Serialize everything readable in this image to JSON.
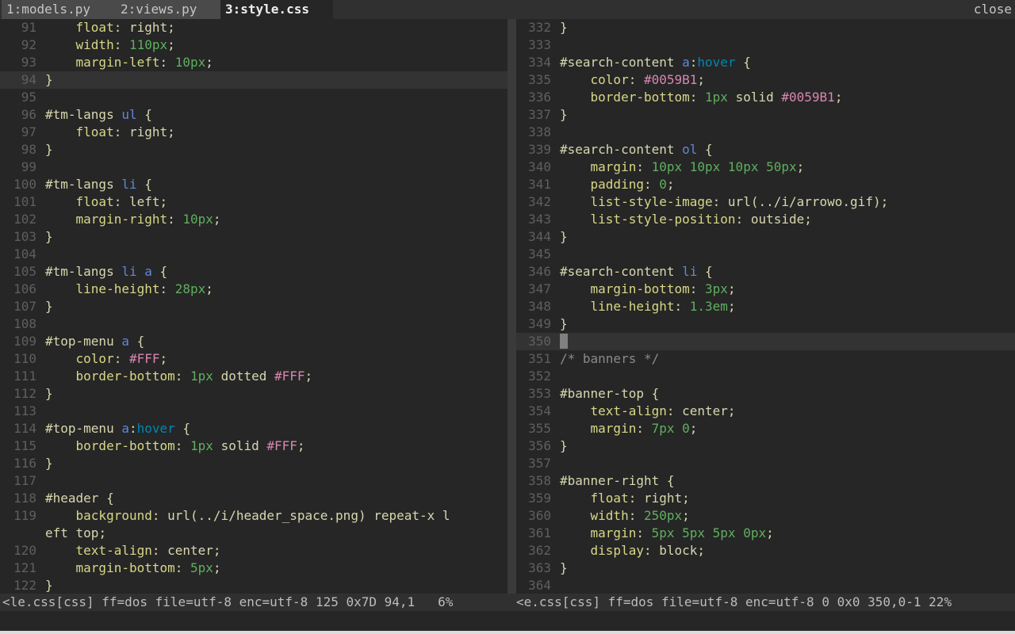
{
  "tabline": {
    "tabs": [
      {
        "label": "1:models.py"
      },
      {
        "label": "2:views.py"
      },
      {
        "label": "3:style.css"
      }
    ],
    "close_label": "close"
  },
  "left_pane": {
    "status": "<le.css[css] ff=dos file=utf-8 enc=utf-8 125 0x7D 94,1   6%",
    "lines": [
      {
        "num": "91",
        "tokens": [
          [
            "plain",
            "    "
          ],
          [
            "prop",
            "float"
          ],
          [
            "punct",
            ": "
          ],
          [
            "val",
            "right"
          ],
          [
            "punct",
            ";"
          ]
        ]
      },
      {
        "num": "92",
        "tokens": [
          [
            "plain",
            "    "
          ],
          [
            "prop",
            "width"
          ],
          [
            "punct",
            ": "
          ],
          [
            "num",
            "110px"
          ],
          [
            "punct",
            ";"
          ]
        ]
      },
      {
        "num": "93",
        "tokens": [
          [
            "plain",
            "    "
          ],
          [
            "prop",
            "margin-left"
          ],
          [
            "punct",
            ": "
          ],
          [
            "num",
            "10px"
          ],
          [
            "punct",
            ";"
          ]
        ]
      },
      {
        "num": "94",
        "cursorline": true,
        "tokens": [
          [
            "brace",
            "}"
          ]
        ]
      },
      {
        "num": "95",
        "tokens": []
      },
      {
        "num": "96",
        "tokens": [
          [
            "sel",
            "#tm-langs "
          ],
          [
            "tag",
            "ul"
          ],
          [
            "brace",
            " {"
          ]
        ]
      },
      {
        "num": "97",
        "tokens": [
          [
            "plain",
            "    "
          ],
          [
            "prop",
            "float"
          ],
          [
            "punct",
            ": "
          ],
          [
            "val",
            "right"
          ],
          [
            "punct",
            ";"
          ]
        ]
      },
      {
        "num": "98",
        "tokens": [
          [
            "brace",
            "}"
          ]
        ]
      },
      {
        "num": "99",
        "tokens": []
      },
      {
        "num": "100",
        "tokens": [
          [
            "sel",
            "#tm-langs "
          ],
          [
            "tag",
            "li"
          ],
          [
            "brace",
            " {"
          ]
        ]
      },
      {
        "num": "101",
        "tokens": [
          [
            "plain",
            "    "
          ],
          [
            "prop",
            "float"
          ],
          [
            "punct",
            ": "
          ],
          [
            "val",
            "left"
          ],
          [
            "punct",
            ";"
          ]
        ]
      },
      {
        "num": "102",
        "tokens": [
          [
            "plain",
            "    "
          ],
          [
            "prop",
            "margin-right"
          ],
          [
            "punct",
            ": "
          ],
          [
            "num",
            "10px"
          ],
          [
            "punct",
            ";"
          ]
        ]
      },
      {
        "num": "103",
        "tokens": [
          [
            "brace",
            "}"
          ]
        ]
      },
      {
        "num": "104",
        "tokens": []
      },
      {
        "num": "105",
        "tokens": [
          [
            "sel",
            "#tm-langs "
          ],
          [
            "tag",
            "li a"
          ],
          [
            "brace",
            " {"
          ]
        ]
      },
      {
        "num": "106",
        "tokens": [
          [
            "plain",
            "    "
          ],
          [
            "prop",
            "line-height"
          ],
          [
            "punct",
            ": "
          ],
          [
            "num",
            "28px"
          ],
          [
            "punct",
            ";"
          ]
        ]
      },
      {
        "num": "107",
        "tokens": [
          [
            "brace",
            "}"
          ]
        ]
      },
      {
        "num": "108",
        "tokens": []
      },
      {
        "num": "109",
        "tokens": [
          [
            "sel",
            "#top-menu "
          ],
          [
            "tag",
            "a"
          ],
          [
            "brace",
            " {"
          ]
        ]
      },
      {
        "num": "110",
        "tokens": [
          [
            "plain",
            "    "
          ],
          [
            "prop",
            "color"
          ],
          [
            "punct",
            ": "
          ],
          [
            "color",
            "#FFF"
          ],
          [
            "punct",
            ";"
          ]
        ]
      },
      {
        "num": "111",
        "tokens": [
          [
            "plain",
            "    "
          ],
          [
            "prop",
            "border-bottom"
          ],
          [
            "punct",
            ": "
          ],
          [
            "num",
            "1px"
          ],
          [
            "val",
            " dotted "
          ],
          [
            "color",
            "#FFF"
          ],
          [
            "punct",
            ";"
          ]
        ]
      },
      {
        "num": "112",
        "tokens": [
          [
            "brace",
            "}"
          ]
        ]
      },
      {
        "num": "113",
        "tokens": []
      },
      {
        "num": "114",
        "tokens": [
          [
            "sel",
            "#top-menu "
          ],
          [
            "tag",
            "a"
          ],
          [
            "punct",
            ":"
          ],
          [
            "pseudo",
            "hover"
          ],
          [
            "brace",
            " {"
          ]
        ]
      },
      {
        "num": "115",
        "tokens": [
          [
            "plain",
            "    "
          ],
          [
            "prop",
            "border-bottom"
          ],
          [
            "punct",
            ": "
          ],
          [
            "num",
            "1px"
          ],
          [
            "val",
            " solid "
          ],
          [
            "color",
            "#FFF"
          ],
          [
            "punct",
            ";"
          ]
        ]
      },
      {
        "num": "116",
        "tokens": [
          [
            "brace",
            "}"
          ]
        ]
      },
      {
        "num": "117",
        "tokens": []
      },
      {
        "num": "118",
        "tokens": [
          [
            "sel",
            "#header"
          ],
          [
            "brace",
            " {"
          ]
        ]
      },
      {
        "num": "119",
        "tokens": [
          [
            "plain",
            "    "
          ],
          [
            "prop",
            "background"
          ],
          [
            "punct",
            ": "
          ],
          [
            "val",
            "url(../i/header_space.png) repeat-x l"
          ]
        ]
      },
      {
        "num": "",
        "tokens": [
          [
            "val",
            "eft top"
          ],
          [
            "punct",
            ";"
          ]
        ]
      },
      {
        "num": "120",
        "tokens": [
          [
            "plain",
            "    "
          ],
          [
            "prop",
            "text-align"
          ],
          [
            "punct",
            ": "
          ],
          [
            "val",
            "center"
          ],
          [
            "punct",
            ";"
          ]
        ]
      },
      {
        "num": "121",
        "tokens": [
          [
            "plain",
            "    "
          ],
          [
            "prop",
            "margin-bottom"
          ],
          [
            "punct",
            ": "
          ],
          [
            "num",
            "5px"
          ],
          [
            "punct",
            ";"
          ]
        ]
      },
      {
        "num": "122",
        "tokens": [
          [
            "brace",
            "}"
          ]
        ]
      }
    ]
  },
  "right_pane": {
    "status": "<e.css[css] ff=dos file=utf-8 enc=utf-8 0 0x0 350,0-1 22%",
    "lines": [
      {
        "num": "332",
        "tokens": [
          [
            "brace",
            "}"
          ]
        ]
      },
      {
        "num": "333",
        "tokens": []
      },
      {
        "num": "334",
        "tokens": [
          [
            "sel",
            "#search-content "
          ],
          [
            "tag",
            "a"
          ],
          [
            "punct",
            ":"
          ],
          [
            "pseudo",
            "hover"
          ],
          [
            "brace",
            " {"
          ]
        ]
      },
      {
        "num": "335",
        "tokens": [
          [
            "plain",
            "    "
          ],
          [
            "prop",
            "color"
          ],
          [
            "punct",
            ": "
          ],
          [
            "color",
            "#0059B1"
          ],
          [
            "punct",
            ";"
          ]
        ]
      },
      {
        "num": "336",
        "tokens": [
          [
            "plain",
            "    "
          ],
          [
            "prop",
            "border-bottom"
          ],
          [
            "punct",
            ": "
          ],
          [
            "num",
            "1px"
          ],
          [
            "val",
            " solid "
          ],
          [
            "color",
            "#0059B1"
          ],
          [
            "punct",
            ";"
          ]
        ]
      },
      {
        "num": "337",
        "tokens": [
          [
            "brace",
            "}"
          ]
        ]
      },
      {
        "num": "338",
        "tokens": []
      },
      {
        "num": "339",
        "tokens": [
          [
            "sel",
            "#search-content "
          ],
          [
            "tag",
            "ol"
          ],
          [
            "brace",
            " {"
          ]
        ]
      },
      {
        "num": "340",
        "tokens": [
          [
            "plain",
            "    "
          ],
          [
            "prop",
            "margin"
          ],
          [
            "punct",
            ": "
          ],
          [
            "num",
            "10px 10px 10px 50px"
          ],
          [
            "punct",
            ";"
          ]
        ]
      },
      {
        "num": "341",
        "tokens": [
          [
            "plain",
            "    "
          ],
          [
            "prop",
            "padding"
          ],
          [
            "punct",
            ": "
          ],
          [
            "num",
            "0"
          ],
          [
            "punct",
            ";"
          ]
        ]
      },
      {
        "num": "342",
        "tokens": [
          [
            "plain",
            "    "
          ],
          [
            "prop",
            "list-style-image"
          ],
          [
            "punct",
            ": "
          ],
          [
            "val",
            "url(../i/arrowo.gif)"
          ],
          [
            "punct",
            ";"
          ]
        ]
      },
      {
        "num": "343",
        "tokens": [
          [
            "plain",
            "    "
          ],
          [
            "prop",
            "list-style-position"
          ],
          [
            "punct",
            ": "
          ],
          [
            "val",
            "outside"
          ],
          [
            "punct",
            ";"
          ]
        ]
      },
      {
        "num": "344",
        "tokens": [
          [
            "brace",
            "}"
          ]
        ]
      },
      {
        "num": "345",
        "tokens": []
      },
      {
        "num": "346",
        "tokens": [
          [
            "sel",
            "#search-content "
          ],
          [
            "tag",
            "li"
          ],
          [
            "brace",
            " {"
          ]
        ]
      },
      {
        "num": "347",
        "tokens": [
          [
            "plain",
            "    "
          ],
          [
            "prop",
            "margin-bottom"
          ],
          [
            "punct",
            ": "
          ],
          [
            "num",
            "3px"
          ],
          [
            "punct",
            ";"
          ]
        ]
      },
      {
        "num": "348",
        "tokens": [
          [
            "plain",
            "    "
          ],
          [
            "prop",
            "line-height"
          ],
          [
            "punct",
            ": "
          ],
          [
            "num",
            "1.3em"
          ],
          [
            "punct",
            ";"
          ]
        ]
      },
      {
        "num": "349",
        "tokens": [
          [
            "brace",
            "}"
          ]
        ]
      },
      {
        "num": "350",
        "cursorline": true,
        "tokens": [
          [
            "cursor",
            " "
          ]
        ]
      },
      {
        "num": "351",
        "tokens": [
          [
            "comment",
            "/* banners */"
          ]
        ]
      },
      {
        "num": "352",
        "tokens": []
      },
      {
        "num": "353",
        "tokens": [
          [
            "sel",
            "#banner-top"
          ],
          [
            "brace",
            " {"
          ]
        ]
      },
      {
        "num": "354",
        "tokens": [
          [
            "plain",
            "    "
          ],
          [
            "prop",
            "text-align"
          ],
          [
            "punct",
            ": "
          ],
          [
            "val",
            "center"
          ],
          [
            "punct",
            ";"
          ]
        ]
      },
      {
        "num": "355",
        "tokens": [
          [
            "plain",
            "    "
          ],
          [
            "prop",
            "margin"
          ],
          [
            "punct",
            ": "
          ],
          [
            "num",
            "7px 0"
          ],
          [
            "punct",
            ";"
          ]
        ]
      },
      {
        "num": "356",
        "tokens": [
          [
            "brace",
            "}"
          ]
        ]
      },
      {
        "num": "357",
        "tokens": []
      },
      {
        "num": "358",
        "tokens": [
          [
            "sel",
            "#banner-right"
          ],
          [
            "brace",
            " {"
          ]
        ]
      },
      {
        "num": "359",
        "tokens": [
          [
            "plain",
            "    "
          ],
          [
            "prop",
            "float"
          ],
          [
            "punct",
            ": "
          ],
          [
            "val",
            "right"
          ],
          [
            "punct",
            ";"
          ]
        ]
      },
      {
        "num": "360",
        "tokens": [
          [
            "plain",
            "    "
          ],
          [
            "prop",
            "width"
          ],
          [
            "punct",
            ": "
          ],
          [
            "num",
            "250px"
          ],
          [
            "punct",
            ";"
          ]
        ]
      },
      {
        "num": "361",
        "tokens": [
          [
            "plain",
            "    "
          ],
          [
            "prop",
            "margin"
          ],
          [
            "punct",
            ": "
          ],
          [
            "num",
            "5px 5px 5px 0px"
          ],
          [
            "punct",
            ";"
          ]
        ]
      },
      {
        "num": "362",
        "tokens": [
          [
            "plain",
            "    "
          ],
          [
            "prop",
            "display"
          ],
          [
            "punct",
            ": "
          ],
          [
            "val",
            "block"
          ],
          [
            "punct",
            ";"
          ]
        ]
      },
      {
        "num": "363",
        "tokens": [
          [
            "brace",
            "}"
          ]
        ]
      },
      {
        "num": "364",
        "tokens": []
      }
    ]
  }
}
